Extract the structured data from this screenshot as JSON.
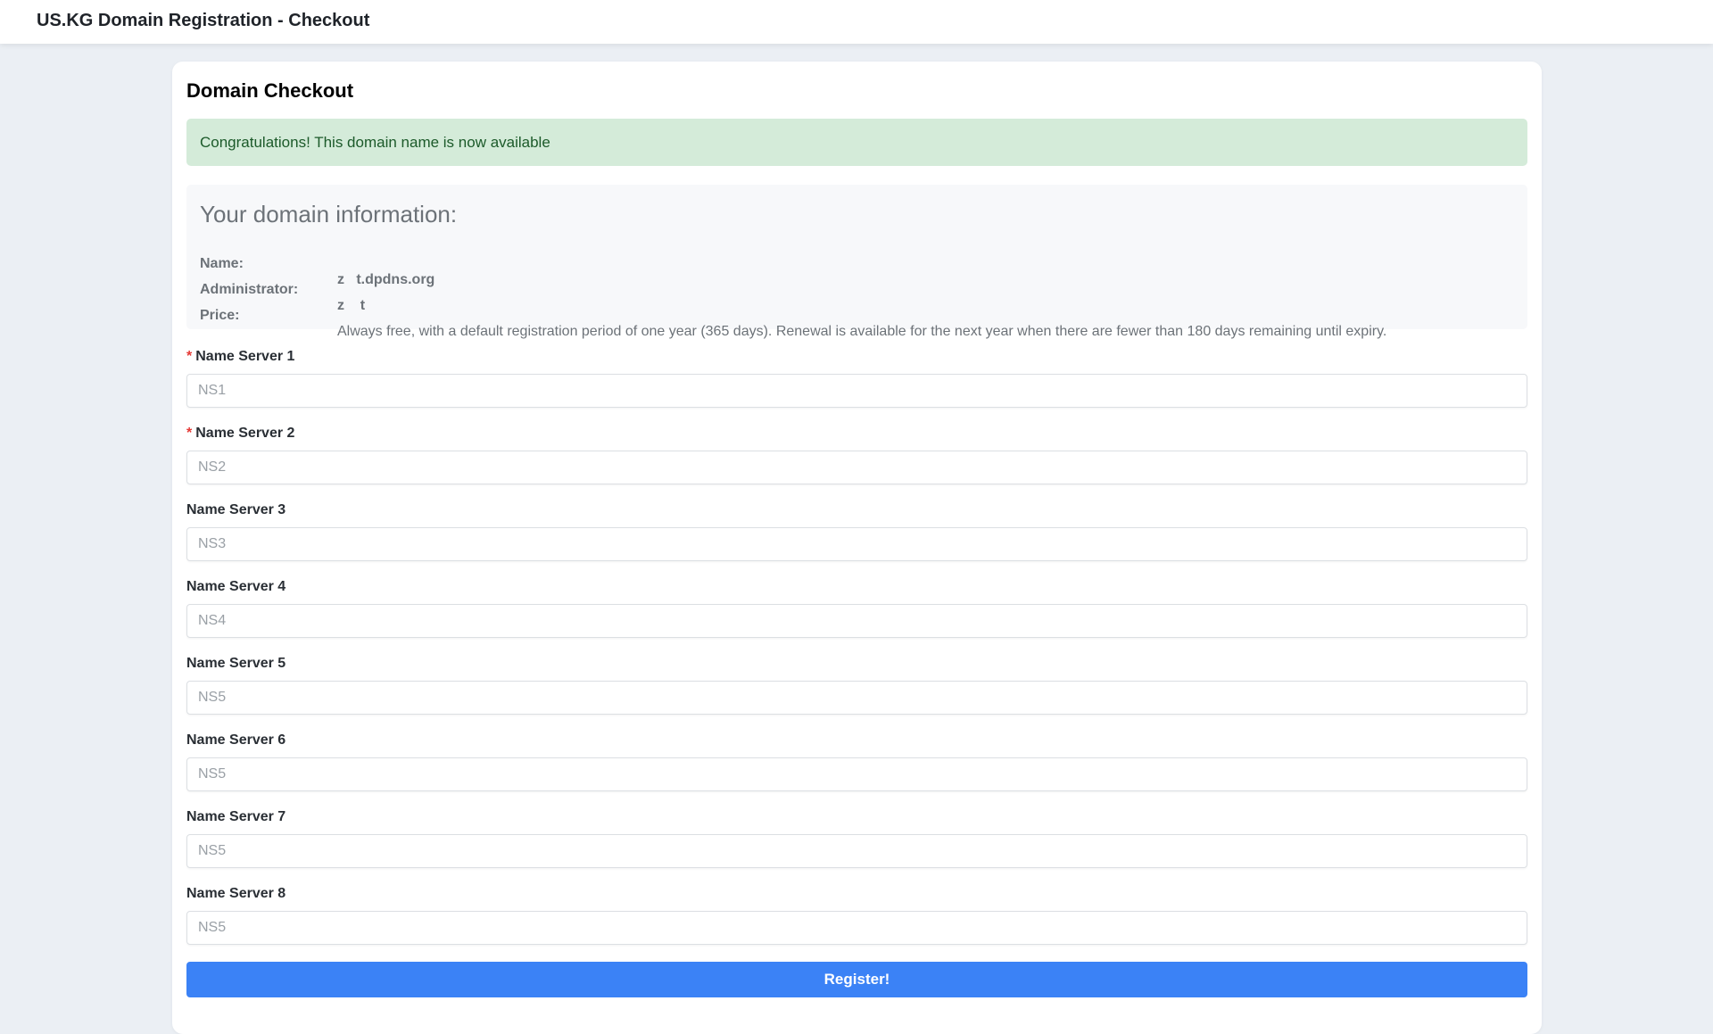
{
  "header": {
    "title": "US.KG Domain Registration - Checkout"
  },
  "card": {
    "heading": "Domain Checkout",
    "alert": "Congratulations! This domain name is now available",
    "info": {
      "title": "Your domain information:",
      "name_label": "Name:",
      "name_value": "z   t.dpdns.org",
      "admin_label": "Administrator:",
      "admin_value": "z    t",
      "price_label": "Price:",
      "price_value": "Always free, with a default registration period of one year (365 days). Renewal is available for the next year when there are fewer than 180 days remaining until expiry."
    },
    "fields": [
      {
        "label": "Name Server 1",
        "placeholder": "NS1",
        "required": "*"
      },
      {
        "label": "Name Server 2",
        "placeholder": "NS2",
        "required": "*"
      },
      {
        "label": "Name Server 3",
        "placeholder": "NS3"
      },
      {
        "label": "Name Server 4",
        "placeholder": "NS4"
      },
      {
        "label": "Name Server 5",
        "placeholder": "NS5"
      },
      {
        "label": "Name Server 6",
        "placeholder": "NS5"
      },
      {
        "label": "Name Server 7",
        "placeholder": "NS5"
      },
      {
        "label": "Name Server 8",
        "placeholder": "NS5"
      }
    ],
    "submit": "Register!"
  }
}
